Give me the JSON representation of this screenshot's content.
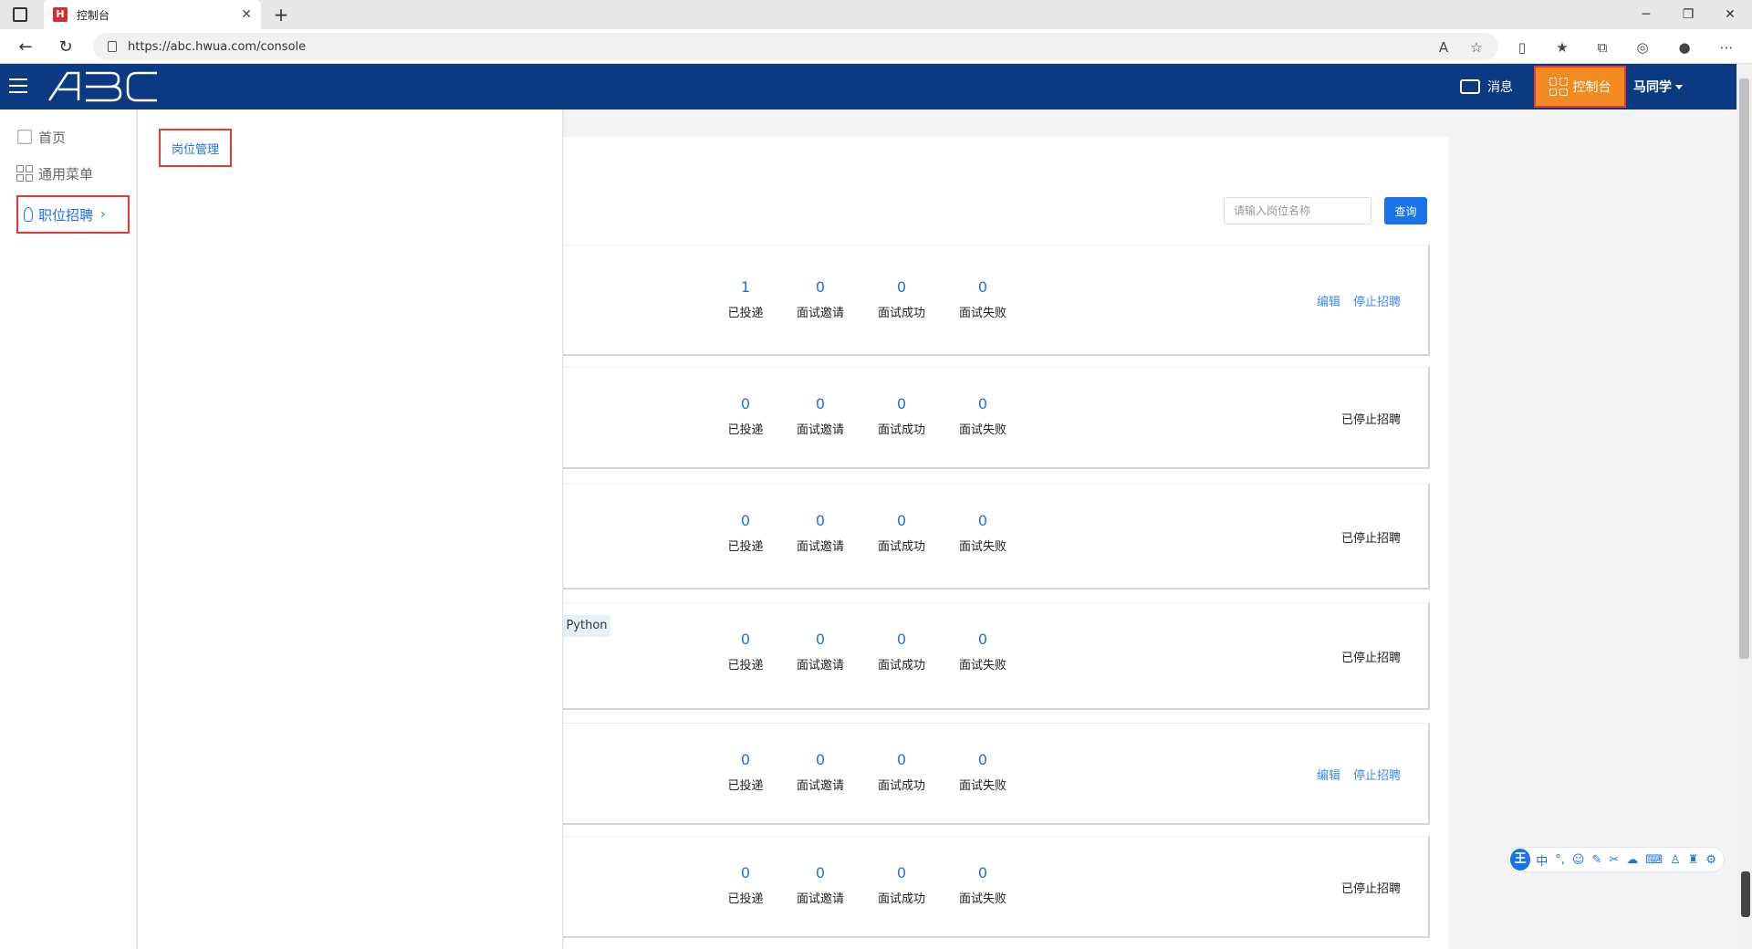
{
  "browser": {
    "tab_title": "控制台",
    "tab_favicon": "H",
    "url": "https://abc.hwua.com/console"
  },
  "header": {
    "logo_text": "ABC",
    "messages_label": "消息",
    "console_label": "控制台",
    "user_name": "马同学"
  },
  "sidebar": {
    "items": [
      {
        "label": "首页",
        "icon": "home-icon"
      },
      {
        "label": "通用菜单",
        "icon": "grid-icon"
      },
      {
        "label": "职位招聘",
        "icon": "tie-icon",
        "active": true
      }
    ]
  },
  "submenu": {
    "items": [
      {
        "label": "岗位管理"
      }
    ]
  },
  "search": {
    "placeholder": "请输入岗位名称",
    "button_label": "查询"
  },
  "stat_labels": [
    "已投递",
    "面试邀请",
    "面试成功",
    "面试失败"
  ],
  "jobs": [
    {
      "stats": [
        "1",
        "0",
        "0",
        "0"
      ],
      "actions": [
        "编辑",
        "停止招聘"
      ],
      "status": ""
    },
    {
      "stats": [
        "0",
        "0",
        "0",
        "0"
      ],
      "actions": [],
      "status": "已停止招聘"
    },
    {
      "stats": [
        "0",
        "0",
        "0",
        "0"
      ],
      "actions": [],
      "status": "已停止招聘"
    },
    {
      "stats": [
        "0",
        "0",
        "0",
        "0"
      ],
      "actions": [],
      "status": "已停止招聘",
      "tag": "Python"
    },
    {
      "stats": [
        "0",
        "0",
        "0",
        "0"
      ],
      "actions": [
        "编辑",
        "停止招聘"
      ],
      "status": ""
    },
    {
      "stats": [
        "0",
        "0",
        "0",
        "0"
      ],
      "actions": [],
      "status": "已停止招聘"
    }
  ],
  "ime": {
    "badge": "王",
    "mode": "中",
    "punct": "°,"
  },
  "colors": {
    "header_bg": "#0b3a82",
    "accent": "#1a73e8",
    "console_bg": "#f28b1f",
    "highlight_border": "#e53935"
  }
}
